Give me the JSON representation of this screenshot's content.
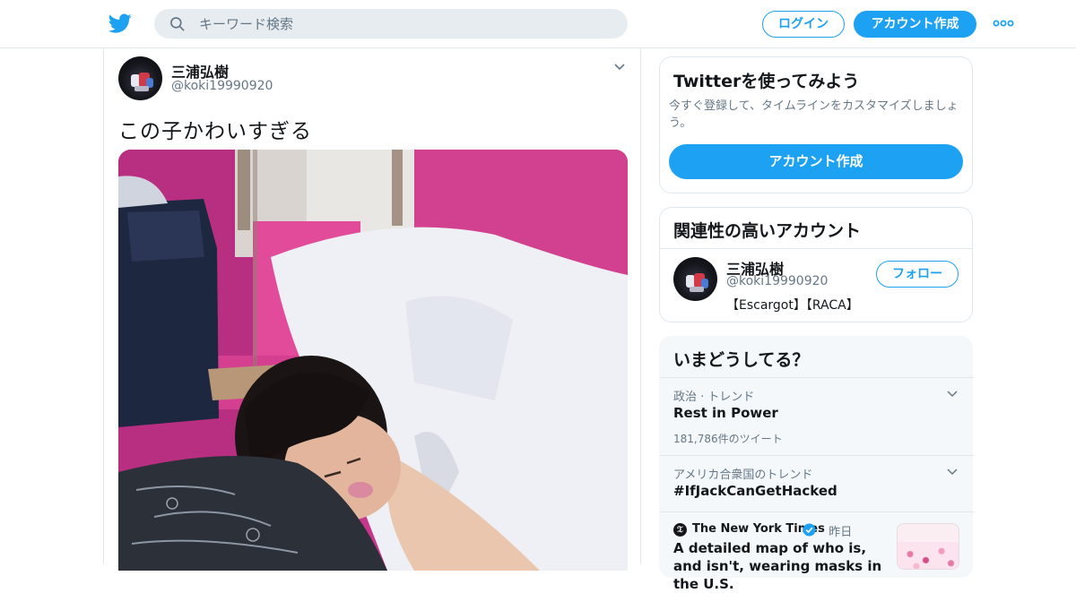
{
  "header": {
    "search_placeholder": "キーワード検索",
    "login_label": "ログイン",
    "signup_label": "アカウント作成"
  },
  "tweet": {
    "author_name": "三浦弘樹",
    "author_handle": "@koki19990920",
    "text": "この子かわいすぎる"
  },
  "sidebar": {
    "signup_card": {
      "title": "Twitterを使ってみよう",
      "description": "今すぐ登録して、タイムラインをカスタマイズしましょう。",
      "button_label": "アカウント作成"
    },
    "related": {
      "title": "関連性の高いアカウント",
      "account_name": "三浦弘樹",
      "account_handle": "@koki19990920",
      "account_bio": "【Escargot】【RACA】",
      "follow_label": "フォロー"
    },
    "trends": {
      "title": "いまどうしてる？",
      "items": [
        {
          "context": "政治 · トレンド",
          "name": "Rest in Power",
          "count": "181,786件のツイート"
        },
        {
          "context": "アメリカ合衆国のトレンド",
          "name": "#IfJackCanGetHacked",
          "count": ""
        }
      ],
      "news": {
        "source": "The New York Times",
        "time": "· 昨日",
        "headline": "A detailed map of who is, and isn't, wearing masks in the U.S."
      }
    }
  },
  "colors": {
    "brand_blue": "#1da1f2",
    "border": "#e1e8ed",
    "muted_text": "#657786"
  },
  "icons": [
    "twitter-bird-icon",
    "search-icon",
    "more-dots-icon",
    "chevron-down-icon",
    "verified-badge-icon",
    "nyt-logo-icon"
  ]
}
